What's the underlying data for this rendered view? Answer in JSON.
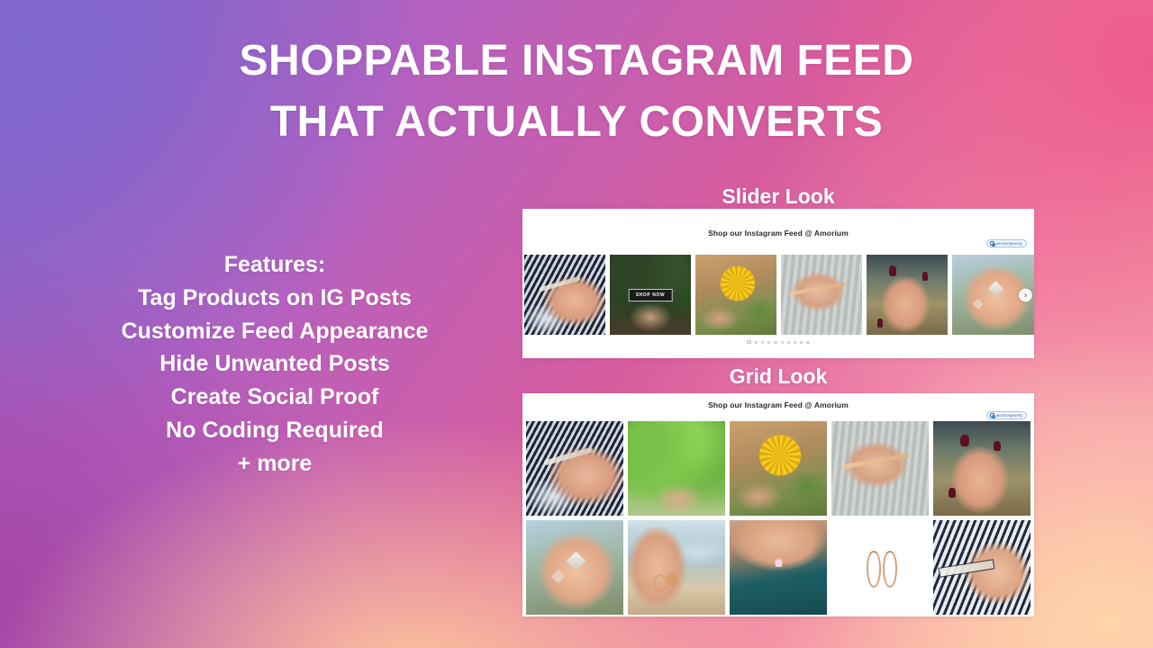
{
  "background": {
    "gradient_colors": [
      "#8e62c8",
      "#b461c0",
      "#d75c9e",
      "#f28aa8",
      "#ffd2a5"
    ],
    "accent_purple": "#8b63c4",
    "accent_pink": "#e8649b",
    "accent_magenta": "#a34ba2",
    "accent_peach": "#ffd2a5"
  },
  "headline": {
    "line1": "SHOPPABLE INSTAGRAM FEED",
    "line2": "THAT ACTUALLY CONVERTS",
    "color": "#ffffff"
  },
  "features": {
    "heading": "Features:",
    "items": [
      "Tag Products on IG Posts",
      "Customize Feed Appearance",
      "Hide Unwanted Posts",
      "Create Social Proof",
      "No Coding Required",
      "+ more"
    ]
  },
  "slider_section": {
    "label": "Slider Look",
    "panel_title": "Shop our Instagram Feed @ Amorium",
    "handle_badge": "amoriumjewelry",
    "handle_icon": "instagram-icon",
    "shop_now_label": "SHOP NOW",
    "next_arrow_icon": "chevron-right-icon",
    "dot_count": 10,
    "active_dot_index": 0,
    "slides": [
      {
        "alt": "hand with bracelets on dark floral scarf",
        "style": "ph-dior",
        "overlay": null
      },
      {
        "alt": "rings on fingers over dark green hedge",
        "style": "ph-hedge",
        "overlay": "SHOP NOW"
      },
      {
        "alt": "sunflower with ring on hand",
        "style": "ph-sunflower",
        "overlay": null
      },
      {
        "alt": "bracelets on wrist at rocky shore",
        "style": "ph-shore",
        "overlay": null
      },
      {
        "alt": "hand with dark red nails and stacked rings",
        "style": "ph-darknails",
        "overlay": null
      },
      {
        "alt": "layered pendant necklaces in palm",
        "style": "ph-necklace",
        "overlay": null
      }
    ]
  },
  "grid_section": {
    "label": "Grid Look",
    "panel_title": "Shop our Instagram Feed @ Amorium",
    "handle_badge": "amoriumjewelry",
    "handle_icon": "instagram-icon",
    "rows": [
      [
        {
          "alt": "hand with bracelets on dark floral scarf",
          "style": "ph-dior"
        },
        {
          "alt": "rings on fingers over bright green bushes",
          "style": "ph-green"
        },
        {
          "alt": "sunflower with ring on hand",
          "style": "ph-sunflower"
        },
        {
          "alt": "bracelets on wrist at rocky shore",
          "style": "ph-shore"
        },
        {
          "alt": "hand with dark red nails and stacked rings",
          "style": "ph-darknails"
        }
      ],
      [
        {
          "alt": "layered pendant necklaces in palm",
          "style": "ph-necklace"
        },
        {
          "alt": "ear with hoop earrings at the beach",
          "style": "ph-ear"
        },
        {
          "alt": "pendant necklace with teal top",
          "style": "ph-teal"
        },
        {
          "alt": "snake hoop earrings product shot",
          "style": "ph-product"
        },
        {
          "alt": "hand with rings on light Dior scarf",
          "style": "ph-dior2"
        }
      ]
    ]
  }
}
